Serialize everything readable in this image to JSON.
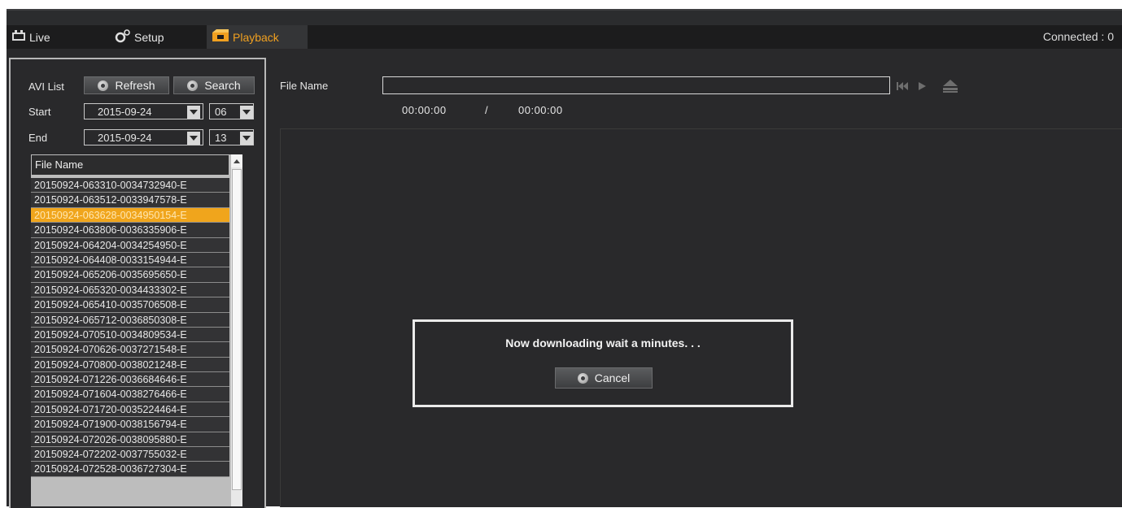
{
  "tabs": {
    "live_label": "Live",
    "setup_label": "Setup",
    "playback_label": "Playback"
  },
  "status": {
    "connected": "Connected : 0"
  },
  "panel": {
    "avi_list_label": "AVI List",
    "refresh_label": "Refresh",
    "search_label": "Search",
    "start_label": "Start",
    "end_label": "End",
    "start_date": "2015-09-24",
    "start_hour": "06",
    "end_date": "2015-09-24",
    "end_hour": "13",
    "list_header": "File Name",
    "files": [
      "20150924-063310-0034732940-E",
      "20150924-063512-0033947578-E",
      "20150924-063628-0034950154-E",
      "20150924-063806-0036335906-E",
      "20150924-064204-0034254950-E",
      "20150924-064408-0033154944-E",
      "20150924-065206-0035695650-E",
      "20150924-065320-0034433302-E",
      "20150924-065410-0035706508-E",
      "20150924-065712-0036850308-E",
      "20150924-070510-0034809534-E",
      "20150924-070626-0037271548-E",
      "20150924-070800-0038021248-E",
      "20150924-071226-0036684646-E",
      "20150924-071604-0038276466-E",
      "20150924-071720-0035224464-E",
      "20150924-071900-0038156794-E",
      "20150924-072026-0038095880-E",
      "20150924-072202-0037755032-E",
      "20150924-072528-0036727304-E"
    ],
    "selected_index": 2
  },
  "player": {
    "filename_label": "File Name",
    "filename_value": "",
    "time_current": "00:00:00",
    "time_separator": "/",
    "time_total": "00:00:00"
  },
  "dialog": {
    "message": "Now downloading wait a minutes. . .",
    "cancel_label": "Cancel"
  },
  "colors": {
    "accent": "#f0a51c",
    "background": "#29292b"
  }
}
